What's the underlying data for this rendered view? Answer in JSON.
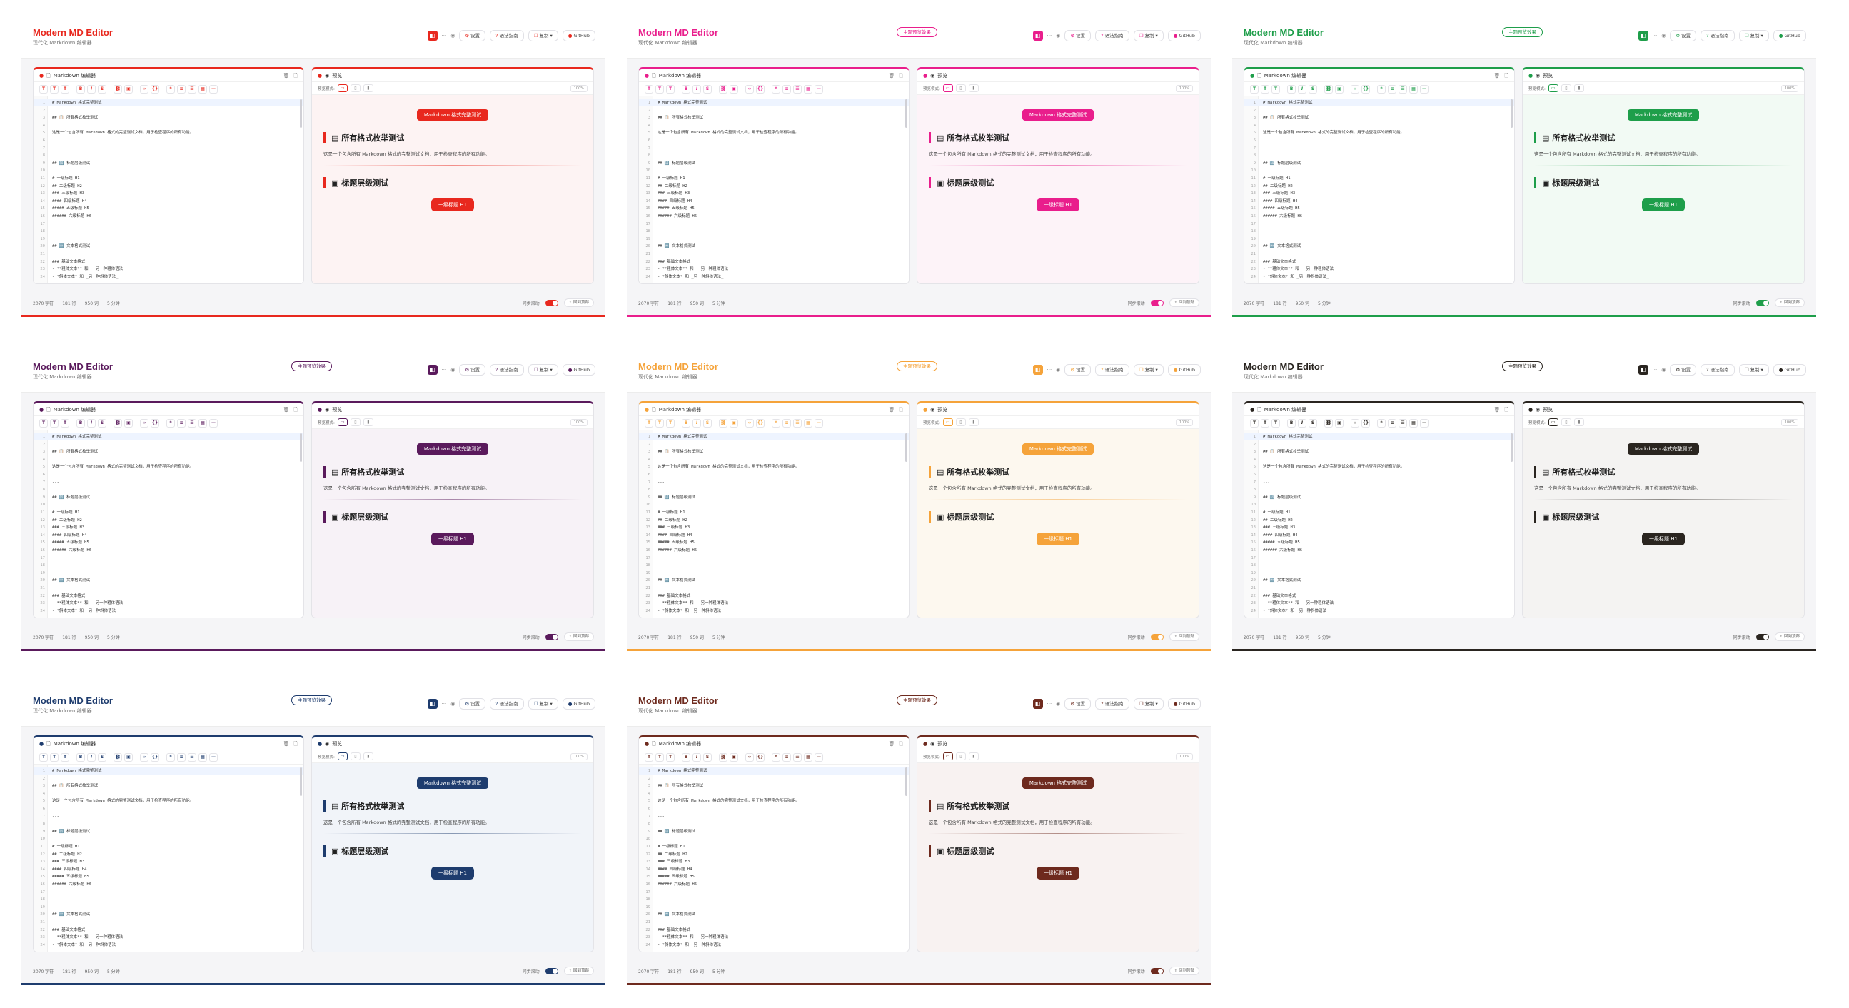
{
  "app": {
    "title": "Modern MD Editor",
    "subtitle": "现代化 Markdown 编辑器"
  },
  "header": {
    "buttons": [
      "设置",
      "语法指南",
      "复制",
      "GitHub"
    ]
  },
  "editor": {
    "title": "Markdown 编辑器",
    "lines": [
      "# Markdown 格式完整测试",
      "",
      "## 📋 所有格式枚举测试",
      "",
      "这是一个包含所有 Markdown 格式的完整测试文档，用于检查程序的所有功能。",
      "",
      "---",
      "",
      "## 🔢 标题层级测试",
      "",
      "# 一级标题 H1",
      "## 二级标题 H2",
      "### 三级标题 H3",
      "#### 四级标题 H4",
      "##### 五级标题 H5",
      "###### 六级标题 H6",
      "",
      "---",
      "",
      "## 🔤 文本格式测试",
      "",
      "### 基础文本格式",
      "- **粗体文本** 和 __另一种粗体语法__",
      "- *斜体文本* 和 _另一种斜体语法_"
    ]
  },
  "preview": {
    "title": "预览",
    "toolbar_label": "预览模式:",
    "zoom": "100%",
    "doc_title": "Markdown 格式完整测试",
    "h2_all": "所有格式枚举测试",
    "para": "这是一个包含所有 Markdown 格式的完整测试文档，用于检查程序的所有功能。",
    "h2_levels": "标题层级测试",
    "h1_label": "一级标题 H1",
    "h2_label": "二级标题 H2"
  },
  "status": {
    "chars": "2070 字符",
    "lines": "181 行",
    "words": "950 词",
    "read": "5 分钟",
    "sync_label": "同步滚动",
    "back_top": "回到顶部"
  },
  "themes": [
    {
      "accent": "#e8281e",
      "tint": "#fdf3f3",
      "badge": ""
    },
    {
      "accent": "#e91e8c",
      "tint": "#fdf3f8",
      "badge": "主题预览效果"
    },
    {
      "accent": "#1e9e4a",
      "tint": "#f2faf4",
      "badge": "主题预览效果"
    },
    {
      "accent": "#5a1a5c",
      "tint": "#f7f2f7",
      "badge": "主题预览效果"
    },
    {
      "accent": "#f5a33a",
      "tint": "#fdf8ef",
      "badge": "主题预览效果"
    },
    {
      "accent": "#2a2520",
      "tint": "#f4f3f2",
      "badge": "主题预览效果"
    },
    {
      "accent": "#1e3c6e",
      "tint": "#f1f4f9",
      "badge": "主题预览效果"
    },
    {
      "accent": "#6e2a1e",
      "tint": "#f8f2f1",
      "badge": "主题预览效果"
    }
  ]
}
